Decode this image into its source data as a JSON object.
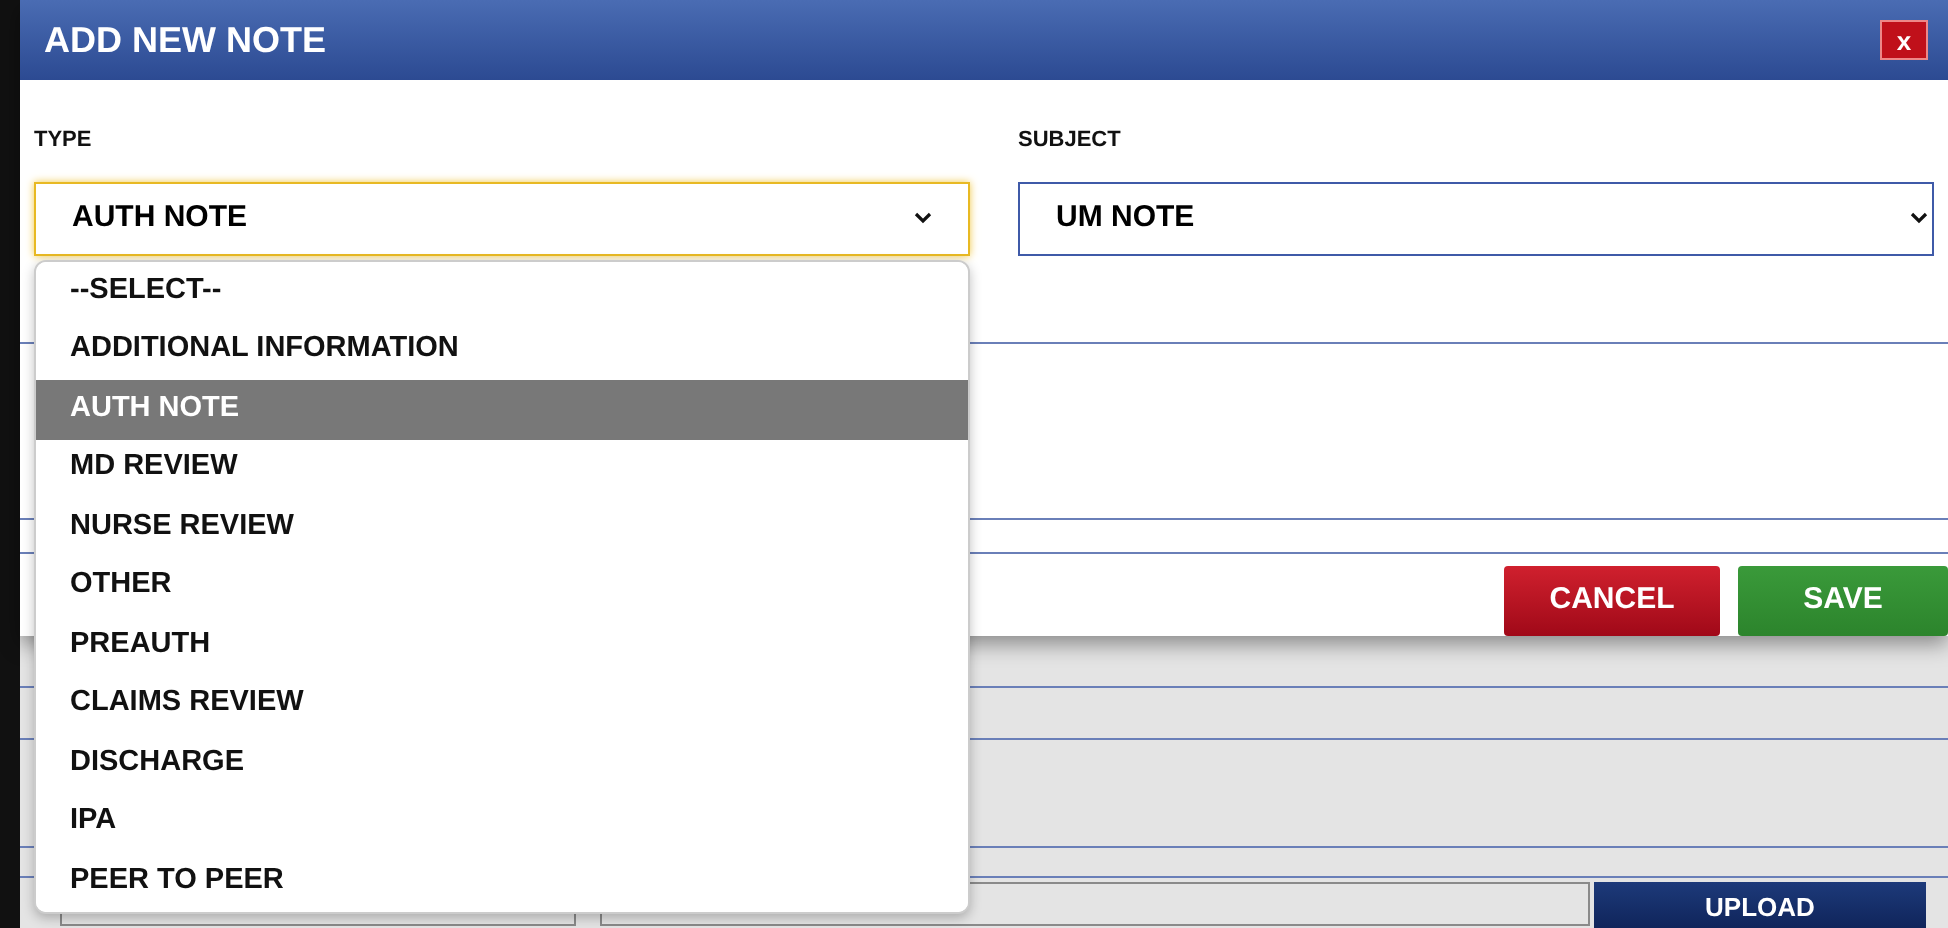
{
  "dialog": {
    "title": "ADD NEW NOTE",
    "close_label": "x"
  },
  "type_field": {
    "label": "TYPE",
    "value": "AUTH NOTE",
    "expanded": true
  },
  "subject_field": {
    "label": "SUBJECT",
    "value": "UM NOTE"
  },
  "type_options": [
    {
      "label": "--SELECT--",
      "selected": false
    },
    {
      "label": "ADDITIONAL INFORMATION",
      "selected": false
    },
    {
      "label": "AUTH NOTE",
      "selected": true
    },
    {
      "label": "MD REVIEW",
      "selected": false
    },
    {
      "label": "NURSE REVIEW",
      "selected": false
    },
    {
      "label": "OTHER",
      "selected": false
    },
    {
      "label": "PREAUTH",
      "selected": false
    },
    {
      "label": "CLAIMS REVIEW",
      "selected": false
    },
    {
      "label": "DISCHARGE",
      "selected": false
    },
    {
      "label": "IPA",
      "selected": false
    },
    {
      "label": "PEER TO PEER",
      "selected": false
    }
  ],
  "buttons": [
    {
      "label": "CANCEL",
      "kind": "cancel"
    },
    {
      "label": "SAVE",
      "kind": "save"
    }
  ],
  "background_page": {
    "upload_button": "UPLOAD"
  }
}
